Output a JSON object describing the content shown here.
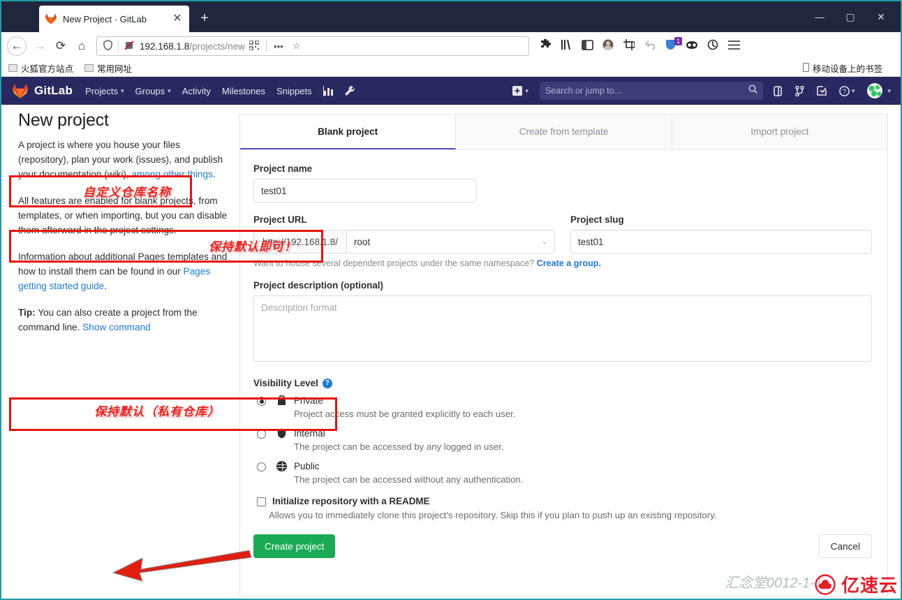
{
  "browser": {
    "tab": {
      "title": "New Project · GitLab",
      "favicon": "gitlab-fox-icon",
      "close_label": "✕"
    },
    "new_tab_label": "+",
    "window_controls": {
      "minimize": "—",
      "maximize": "▢",
      "close": "✕"
    },
    "nav": {
      "back": "←",
      "forward": "→",
      "reload": "⟳",
      "home": "⌂",
      "url_host": "192.168.1.8",
      "url_path": "/projects/new",
      "shield_icon": "shield-icon",
      "reader_icon": "reader-strikethrough-icon",
      "qr_icon": "qr-code-icon",
      "page_actions": "•••",
      "bookmark_star": "☆"
    },
    "toolbar_icons": [
      "puzzle-extension-icon",
      "library-icon",
      "sidebar-icon",
      "account-avatar-icon",
      "screenshot-icon",
      "undo-icon",
      "pocket-badge-icon",
      "mask-icon",
      "sync-icon",
      "hamburger-menu-icon"
    ],
    "toolbar_badge": "1",
    "bookmarks": [
      {
        "label": "火狐官方站点",
        "icon": "folder-icon"
      },
      {
        "label": "常用网址",
        "icon": "folder-icon"
      }
    ],
    "bookmarks_right": {
      "label": "移动设备上的书签",
      "icon": "mobile-icon"
    }
  },
  "gitlab_nav": {
    "brand": "GitLab",
    "links": [
      {
        "label": "Projects",
        "caret": "▾"
      },
      {
        "label": "Groups",
        "caret": "▾"
      },
      {
        "label": "Activity",
        "caret": ""
      },
      {
        "label": "Milestones",
        "caret": ""
      },
      {
        "label": "Snippets",
        "caret": ""
      }
    ],
    "icons": [
      "analytics-chart-icon",
      "wrench-admin-icon"
    ],
    "plus": {
      "label": "＋",
      "caret": "▾"
    },
    "search_placeholder": "Search or jump to...",
    "right_icons": [
      "merge-request-icon",
      "issues-icon",
      "todos-icon"
    ],
    "help": {
      "icon": "help-question-icon",
      "caret": "▾"
    },
    "user": {
      "avatar": "user-avatar-icon",
      "caret": "▾"
    }
  },
  "sidebar": {
    "title": "New project",
    "p1_a": "A project is where you house your files (repository), plan your work (issues), and publish your documentation (wiki), ",
    "p1_link": "among other things",
    "p1_b": ".",
    "p2": "All features are enabled for blank projects, from templates, or when importing, but you can disable them afterward in the project settings.",
    "p3_a": "Information about additional Pages templates and how to install them can be found in our ",
    "p3_link": "Pages getting started guide",
    "p3_b": ".",
    "tip_label": "Tip:",
    "tip_a": " You can also create a project from the command line. ",
    "tip_link": "Show command"
  },
  "tabs": [
    {
      "label": "Blank project",
      "active": true
    },
    {
      "label": "Create from template",
      "active": false
    },
    {
      "label": "Import project",
      "active": false
    }
  ],
  "form": {
    "project_name_label": "Project name",
    "project_name_value": "test01",
    "project_url_label": "Project URL",
    "project_url_prefix": "http://192.168.1.8/",
    "project_url_namespace": "root",
    "namespace_caret": "⌄",
    "project_slug_label": "Project slug",
    "project_slug_value": "test01",
    "helper_text": "Want to house several dependent projects under the same namespace? ",
    "helper_link": "Create a group.",
    "description_label": "Project description (optional)",
    "description_placeholder": "Description format",
    "visibility_label": "Visibility Level",
    "visibility_help_icon": "help-question-icon",
    "visibility_options": [
      {
        "name": "Private",
        "icon": "lock-icon",
        "desc": "Project access must be granted explicitly to each user.",
        "selected": true
      },
      {
        "name": "Internal",
        "icon": "shield-icon",
        "desc": "The project can be accessed by any logged in user.",
        "selected": false
      },
      {
        "name": "Public",
        "icon": "globe-icon",
        "desc": "The project can be accessed without any authentication.",
        "selected": false
      }
    ],
    "readme_label": "Initialize repository with a README",
    "readme_desc": "Allows you to immediately clone this project’s repository. Skip this if you plan to push up an existing repository.",
    "create_button": "Create project",
    "cancel_button": "Cancel"
  },
  "annotations": {
    "project_name_note": "自定义仓库名称",
    "project_url_note": "保持默认即可！",
    "visibility_note": "保持默认（私有仓库）",
    "accent_red": "#e8120f",
    "arrow_color": "#e01f13"
  },
  "watermark": {
    "ghost_text": "汇念堂0012-1-1",
    "brand": "亿速云",
    "logo": "cloud-logo-icon"
  }
}
